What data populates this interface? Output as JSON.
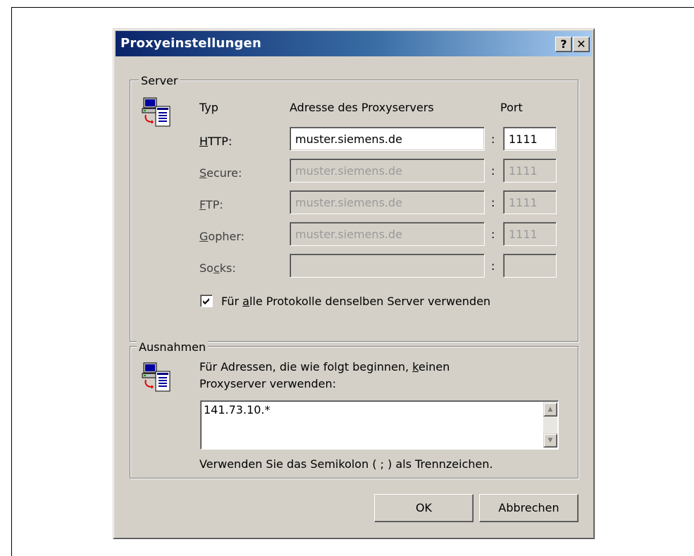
{
  "dialog": {
    "title": "Proxyeinstellungen",
    "help_glyph": "?",
    "close_glyph": "✕"
  },
  "server": {
    "group_label": "Server",
    "col_type": "Typ",
    "col_address": "Adresse des Proxyservers",
    "col_port": "Port",
    "separator": ":",
    "rows": [
      {
        "pre": "",
        "acc": "H",
        "post": "TTP:",
        "address": "muster.siemens.de",
        "port": "1111",
        "enabled": true
      },
      {
        "pre": "",
        "acc": "S",
        "post": "ecure:",
        "address": "muster.siemens.de",
        "port": "1111",
        "enabled": false
      },
      {
        "pre": "",
        "acc": "F",
        "post": "TP:",
        "address": "muster.siemens.de",
        "port": "1111",
        "enabled": false
      },
      {
        "pre": "",
        "acc": "G",
        "post": "opher:",
        "address": "muster.siemens.de",
        "port": "1111",
        "enabled": false
      },
      {
        "pre": "So",
        "acc": "c",
        "post": "ks:",
        "address": "",
        "port": "",
        "enabled": false
      }
    ],
    "same_server": {
      "checked": true,
      "pre": "Für ",
      "acc": "a",
      "post": "lle Protokolle denselben Server verwenden"
    }
  },
  "exceptions": {
    "group_label": "Ausnahmen",
    "desc_line1_pre": "Für Adressen, die wie folgt beginnen, ",
    "desc_line1_acc": "k",
    "desc_line1_post": "einen",
    "desc_line2": "Proxyserver verwenden:",
    "value": "141.73.10.*",
    "hint": "Verwenden Sie das Semikolon ( ; ) als Trennzeichen."
  },
  "buttons": {
    "ok": "OK",
    "cancel": "Abbrechen"
  },
  "icons": {
    "server_group": "network-computers-icon",
    "exceptions_group": "network-computers-icon"
  }
}
